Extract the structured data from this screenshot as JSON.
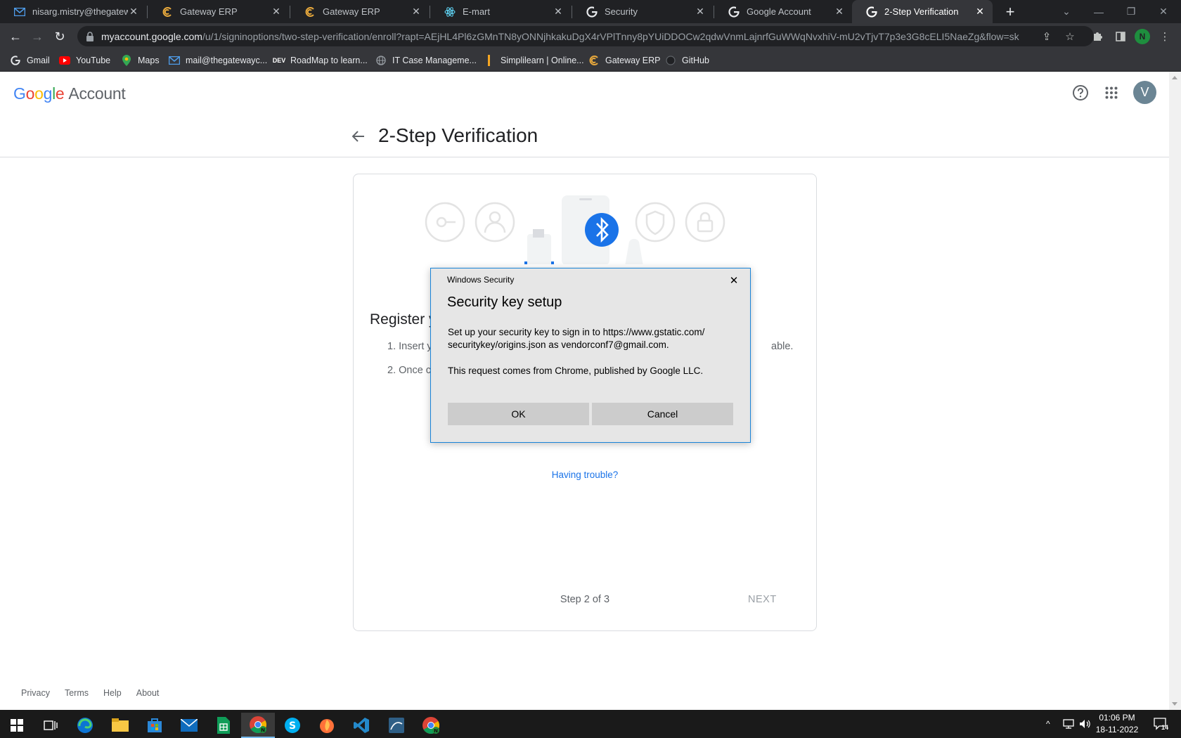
{
  "browser": {
    "tabs": [
      {
        "title": "nisarg.mistry@thegatewa",
        "icon": "mail-icon"
      },
      {
        "title": "Gateway ERP",
        "icon": "gateway-icon"
      },
      {
        "title": "Gateway ERP",
        "icon": "gateway-icon"
      },
      {
        "title": "E-mart",
        "icon": "react-icon"
      },
      {
        "title": "Security",
        "icon": "google-icon"
      },
      {
        "title": "Google Account",
        "icon": "google-icon"
      },
      {
        "title": "2-Step Verification",
        "icon": "google-icon",
        "active": true
      }
    ],
    "url_host": "myaccount.google.com",
    "url_path": "/u/1/signinoptions/two-step-verification/enroll?rapt=AEjHL4Pl6zGMnTN8yONNjhkakuDgX4rVPlTnny8pYUiDDOCw2qdwVnmLajnrfGuWWqNvxhiV-mU2vTjvT7p3e3G8cELI5NaeZg&flow=sk",
    "profile_initial": "N",
    "bookmarks": [
      {
        "label": "Gmail",
        "icon": "google-icon"
      },
      {
        "label": "YouTube",
        "icon": "youtube-icon"
      },
      {
        "label": "Maps",
        "icon": "maps-icon"
      },
      {
        "label": "mail@thegatewayc...",
        "icon": "mail-icon"
      },
      {
        "label": "RoadMap to learn...",
        "icon": "dev-icon"
      },
      {
        "label": "IT Case Manageme...",
        "icon": "globe-icon"
      },
      {
        "label": "Simplilearn | Online...",
        "icon": "simplilearn-icon"
      },
      {
        "label": "Gateway ERP",
        "icon": "gateway-icon"
      },
      {
        "label": "GitHub",
        "icon": "github-icon"
      }
    ]
  },
  "header": {
    "logo_google": "Google",
    "logo_account": "Account",
    "avatar_initial": "V"
  },
  "page": {
    "title": "2-Step Verification",
    "register_title": "Register y",
    "step1": "1. Insert y",
    "step1_tail": "able.",
    "step2": "2. Once c",
    "trouble_link": "Having trouble?",
    "step_counter": "Step 2 of 3",
    "next_label": "NEXT"
  },
  "footer": {
    "links": [
      "Privacy",
      "Terms",
      "Help",
      "About"
    ]
  },
  "dialog": {
    "caption": "Windows Security",
    "heading": "Security key setup",
    "line1": "Set up your security key to sign in to https://www.gstatic.com/",
    "line2": "securitykey/origins.json as vendorconf7@gmail.com.",
    "line3": "This request comes from Chrome, published by Google LLC.",
    "ok_label": "OK",
    "cancel_label": "Cancel"
  },
  "taskbar": {
    "apps": [
      "start-icon",
      "task-view-icon",
      "edge-icon",
      "file-explorer-icon",
      "store-icon",
      "mail-app-icon",
      "sheets-icon",
      "chrome-icon",
      "skype-icon",
      "firefox-dev-icon",
      "vscode-icon",
      "mysql-workbench-icon",
      "chrome-profile-icon"
    ],
    "time": "01:06 PM",
    "date": "18-11-2022",
    "notification_count": "14"
  },
  "colors": {
    "accent_blue": "#1a73e8",
    "dialog_border": "#1883d7",
    "chrome_dark": "#202124",
    "chrome_toolbar": "#35363a"
  }
}
